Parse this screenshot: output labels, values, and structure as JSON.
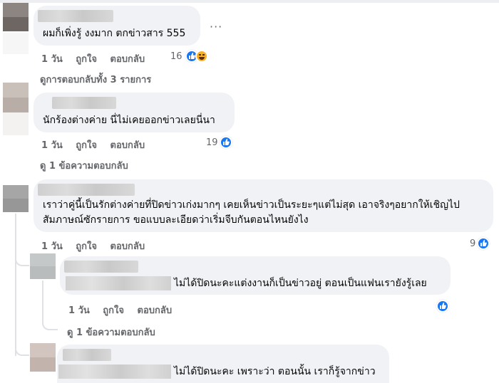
{
  "comments": [
    {
      "text": "ผมก็เพิ่งรู้ งงมาก ตกข่าวสาร 555",
      "more": "···",
      "time": "1 วัน",
      "like": "ถูกใจ",
      "reply": "ตอบกลับ",
      "reaction_count": "16",
      "reactions": [
        "like-icon",
        "haha-icon"
      ],
      "view_replies": "ดูการตอบกลับทั้ง 3 รายการ"
    },
    {
      "text": "นักร้องต่างค่าย นี่ไม่เคยออกข่าวเลยนี่นา",
      "time": "1 วัน",
      "like": "ถูกใจ",
      "reply": "ตอบกลับ",
      "reaction_count": "19",
      "reactions": [
        "like-icon"
      ],
      "view_replies": "ดู 1 ข้อความตอบกลับ"
    },
    {
      "text": "เราว่าคู่นี้เป็นรักต่างค่ายที่ปิดข่าวเก่งมากๆ เคยเห็นข่าวเป็นระยะๆแต่ไม่สุด เอาจริงๆอยากให้เชิญไปสัมภาษณ์ซักรายการ ขอแบบละเอียดว่าเริ่มจีบกันตอนไหนยังไง",
      "time": "1 วัน",
      "like": "ถูกใจ",
      "reply": "ตอบกลับ",
      "reaction_count": "9",
      "reactions": [
        "like-icon"
      ]
    }
  ],
  "replies": [
    {
      "text": "ไม่ได้ปิดนะคะแต่งงานก็เป็นข่าวอยู่ ตอนเป็นแฟนเรายังรู้เลย",
      "time": "1 วัน",
      "like": "ถูกใจ",
      "reply": "ตอบกลับ",
      "reactions": [
        "like-icon"
      ],
      "view_replies": "ดู 1 ข้อความตอบกลับ"
    },
    {
      "text": "ไม่ได้ปิดนะคะ เพราะว่า ตอนนั้น เราก็รู้จากข่าว"
    }
  ],
  "colors": {
    "bubble": "#f0f2f5",
    "meta_text": "#65676b",
    "like_blue": "#1877f2"
  }
}
